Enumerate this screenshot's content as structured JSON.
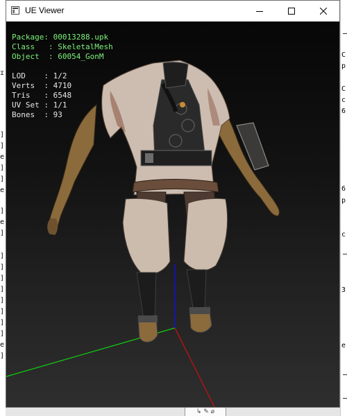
{
  "window": {
    "title": "UE Viewer"
  },
  "info_panel": {
    "package": {
      "label": "Package: ",
      "value": "00013288.upk"
    },
    "class": {
      "label": "Class   : ",
      "value": "SkeletalMesh"
    },
    "object": {
      "label": "Object  : ",
      "value": "60054_GonM"
    },
    "lod": {
      "label": "LOD    : ",
      "value": "1/2"
    },
    "verts": {
      "label": "Verts  : ",
      "value": "4710"
    },
    "tris": {
      "label": "Tris   : ",
      "value": "6548"
    },
    "uvset": {
      "label": "UV Set : ",
      "value": "1/1"
    },
    "bones": {
      "label": "Bones  : ",
      "value": "93"
    }
  },
  "axes": {
    "x_color": "#d01010",
    "y_color": "#10d010",
    "z_color": "#1010e0"
  },
  "colors": {
    "package_text": "#7df27d",
    "stats_text": "#e6e6e6"
  }
}
